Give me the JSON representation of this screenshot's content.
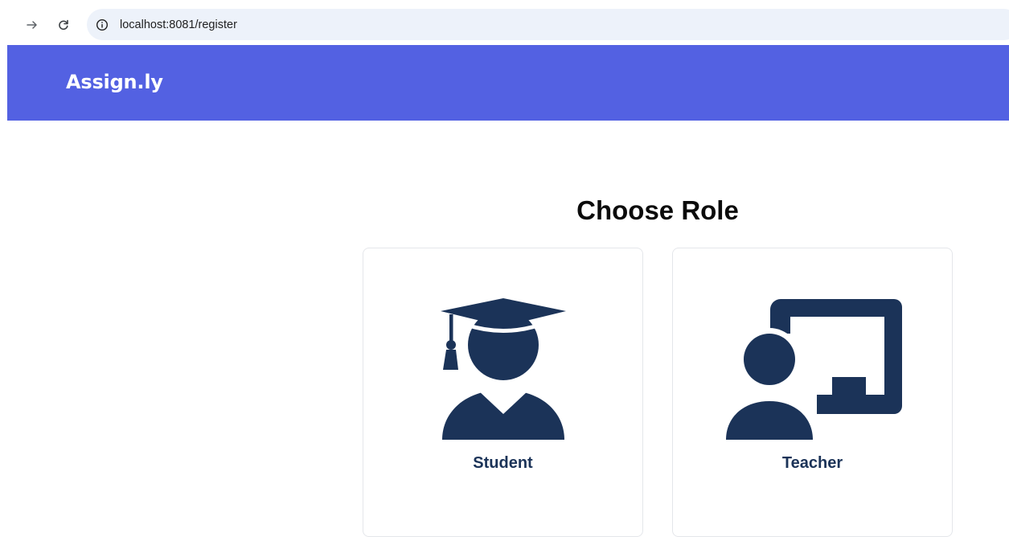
{
  "browser": {
    "url": "localhost:8081/register",
    "icons": [
      "arrow-forward-icon",
      "reload-icon",
      "site-info-icon"
    ]
  },
  "header": {
    "brand": "Assign.ly",
    "background_color": "#5361e2"
  },
  "main": {
    "title": "Choose Role",
    "roles": [
      {
        "label": "Student",
        "icon": "student-graduate-icon"
      },
      {
        "label": "Teacher",
        "icon": "teacher-whiteboard-icon"
      }
    ],
    "icon_color": "#1b3358"
  }
}
